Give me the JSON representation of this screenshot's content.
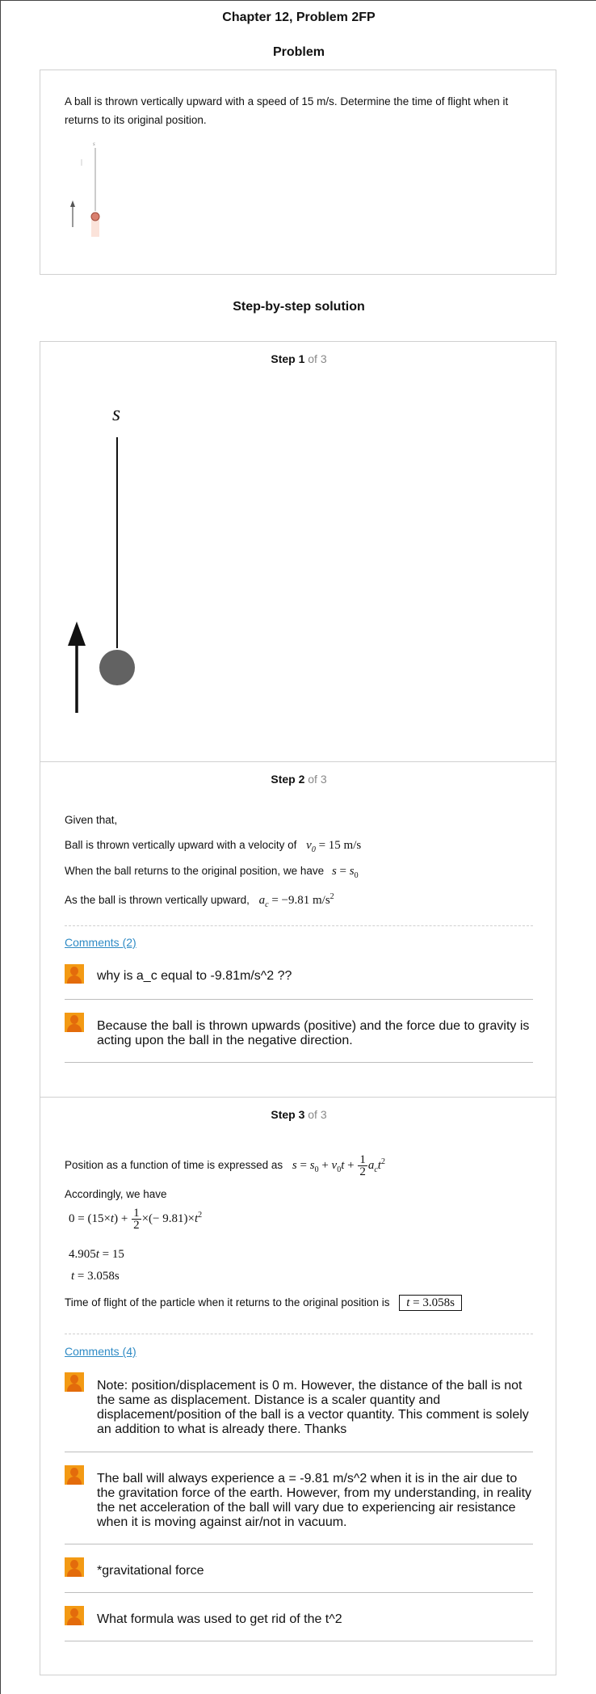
{
  "page": {
    "title": "Chapter 12, Problem 2FP",
    "problem_heading": "Problem",
    "solution_heading": "Step-by-step solution"
  },
  "problem": {
    "text": "A ball is thrown vertically upward with a speed of 15 m/s. Determine the time of flight when it returns to its original position.",
    "figure_label": "s"
  },
  "steps": [
    {
      "label": "Step 1",
      "of": "of 3",
      "figure_label": "s"
    },
    {
      "label": "Step 2",
      "of": "of 3",
      "lines": [
        "Given that,",
        "Ball is thrown vertically upward with a velocity of",
        "When the ball returns to the original position, we have",
        "As the ball is thrown vertically upward,"
      ],
      "math": {
        "v0": "v0 = 15 m/s",
        "s": "s = s0",
        "ac": "ac = −9.81 m/s²"
      },
      "comments_link": "Comments (2)",
      "comments": [
        "why is a_c equal to -9.81m/s^2 ??",
        "Because the ball is thrown upwards (positive) and the force due to gravity is acting upon the ball in the negative direction."
      ]
    },
    {
      "label": "Step 3",
      "of": "of 3",
      "lines": [
        "Position as a function of time is expressed as",
        "Accordingly, we have",
        "Time of flight of the particle when it returns to the original position is"
      ],
      "math": {
        "position": "s = s0 + v0t + 1/2 act²",
        "eq1": "0 = (15×t) + 1/2 × (− 9.81) × t²",
        "eq2": "4.905t = 15",
        "eq3": "t = 3.058s",
        "answer": "t = 3.058s"
      },
      "comments_link": "Comments (4)",
      "comments": [
        "Note: position/displacement is 0 m. However, the distance of the ball is not the same as displacement. Distance is a scaler quantity and displacement/position of the ball is a vector quantity. This comment is solely an addition to what is already there. Thanks",
        "The ball will always experience a = -9.81 m/s^2 when it is in the air due to the gravitation force of the earth. However, from my understanding, in reality the net acceleration of the ball will vary due to experiencing air resistance when it is moving against air/not in vacuum.",
        "*gravitational force",
        "What formula was used to get rid of the t^2"
      ]
    }
  ]
}
